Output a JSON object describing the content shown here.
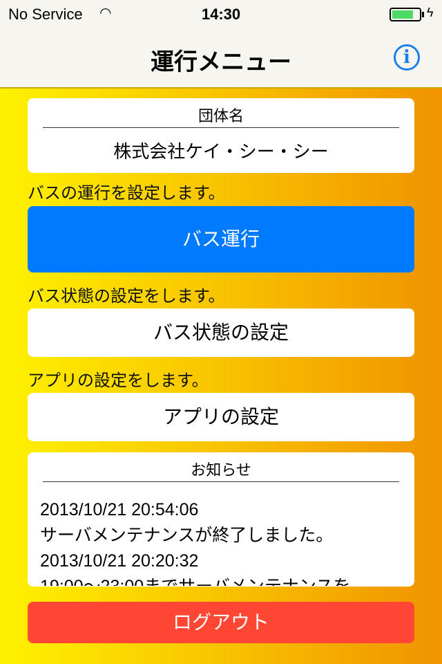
{
  "status_bar": {
    "carrier": "No Service",
    "time": "14:30",
    "battery_level": 0.8
  },
  "nav": {
    "title": "運行メニュー",
    "info_icon": "info-icon"
  },
  "organization": {
    "header": "団体名",
    "value": "株式会社ケイ・シー・シー"
  },
  "bus_operation": {
    "description": "バスの運行を設定します。",
    "button": "バス運行",
    "color": "#007aff"
  },
  "bus_status": {
    "description": "バス状態の設定をします。",
    "button": "バス状態の設定"
  },
  "app_settings": {
    "description": "アプリの設定をします。",
    "button": "アプリの設定"
  },
  "notices": {
    "header": "お知らせ",
    "items": [
      {
        "date": "2013/10/21 20:54:06",
        "text": "サーバメンテナンスが終了しました。"
      },
      {
        "date": "2013/10/21 20:20:32",
        "text": "19:00〜23:00までサーバメンテナンスを"
      }
    ]
  },
  "logout": {
    "button": "ログアウト",
    "color": "#ff4733"
  }
}
